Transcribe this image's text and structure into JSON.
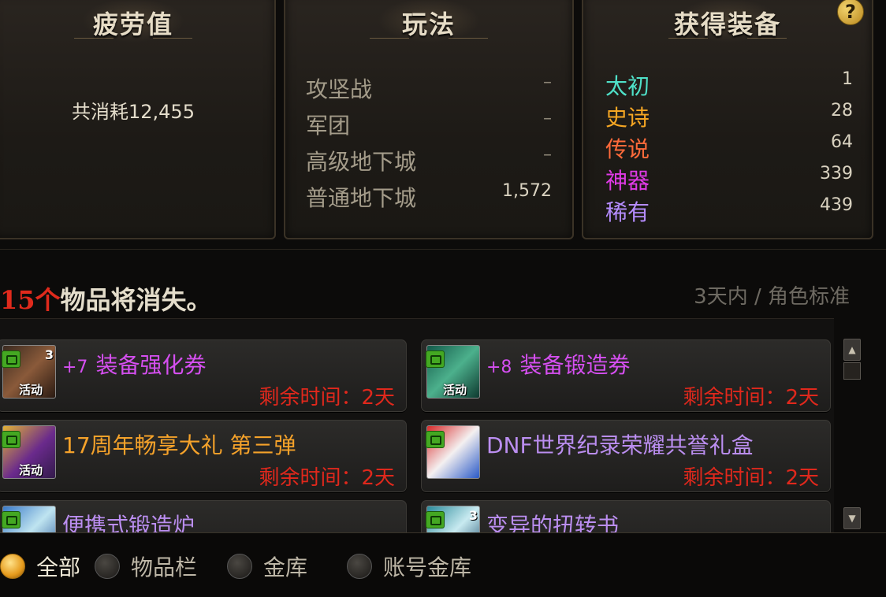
{
  "fatigue": {
    "title": "疲劳值",
    "total": "共消耗12,455"
  },
  "gameplay": {
    "title": "玩法",
    "rows": [
      {
        "label": "攻坚战",
        "value": "–"
      },
      {
        "label": "军团",
        "value": "–"
      },
      {
        "label": "高级地下城",
        "value": "–"
      },
      {
        "label": "普通地下城",
        "value": "1,572"
      }
    ]
  },
  "equipment": {
    "title": "获得装备",
    "help": "?",
    "rows": [
      {
        "label": "太初",
        "value": "1",
        "color": "#4fe0c8"
      },
      {
        "label": "史诗",
        "value": "28",
        "color": "#f5a623"
      },
      {
        "label": "传说",
        "value": "64",
        "color": "#ff6a3a"
      },
      {
        "label": "神器",
        "value": "339",
        "color": "#e03ae6"
      },
      {
        "label": "稀有",
        "value": "439",
        "color": "#b58cff"
      }
    ]
  },
  "expiring": {
    "count": "15个",
    "text": "物品将消失。",
    "range": "3天内 / 角色标准"
  },
  "items": [
    {
      "prefix": "+7",
      "name": "装备强化券",
      "remain": "剩余时间：2天",
      "badge": "活动",
      "stack": "3"
    },
    {
      "prefix": "+8",
      "name": "装备锻造券",
      "remain": "剩余时间：2天",
      "badge": "活动",
      "stack": ""
    },
    {
      "prefix": "",
      "name": "17周年畅享大礼 第三弹",
      "remain": "剩余时间：2天",
      "badge": "活动",
      "stack": ""
    },
    {
      "prefix": "",
      "name": "DNF世界纪录荣耀共誉礼盒",
      "remain": "剩余时间：2天",
      "badge": "",
      "stack": ""
    },
    {
      "prefix": "",
      "name": "便携式锻造炉",
      "remain": "",
      "badge": "",
      "stack": ""
    },
    {
      "prefix": "",
      "name": "变异的扭转书",
      "remain": "",
      "badge": "",
      "stack": "3"
    }
  ],
  "filters": [
    "全部",
    "物品栏",
    "金库",
    "账号金库"
  ],
  "colors": {
    "accent": "#e59a1c",
    "warning": "#e02a1c",
    "epic_purple": "#d54ff0",
    "orange": "#f5a22a",
    "violet": "#bb8ef0"
  }
}
